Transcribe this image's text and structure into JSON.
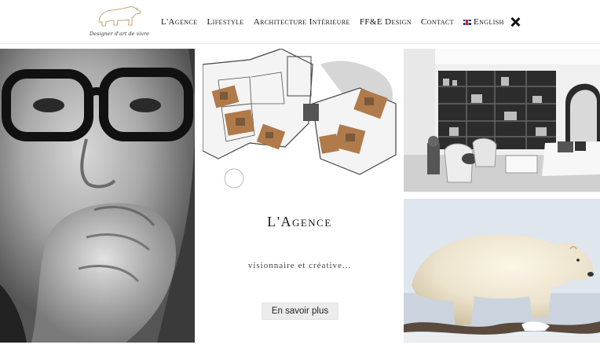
{
  "brand": {
    "logo_icon": "polar-bear-logo-icon",
    "tagline": "Designer d'art de vivre",
    "accent_color": "#c8a878"
  },
  "nav": {
    "items": [
      {
        "label": "L'Agence"
      },
      {
        "label": "Lifestyle"
      },
      {
        "label": "Architecture Intérieure"
      },
      {
        "label": "FF&E Design"
      },
      {
        "label": "Contact"
      }
    ],
    "language": {
      "label": "English",
      "icon": "uk-flag-icon"
    },
    "close_icon": "close-icon"
  },
  "main": {
    "section_title": "L'Agence",
    "section_subtitle": "visionnaire et créative...",
    "cta_label": "En savoir plus"
  },
  "images": {
    "portrait": "portrait-photo",
    "floor_plan": "floor-plan-image",
    "interior": "interior-photo",
    "bear": "polar-bear-photo"
  }
}
